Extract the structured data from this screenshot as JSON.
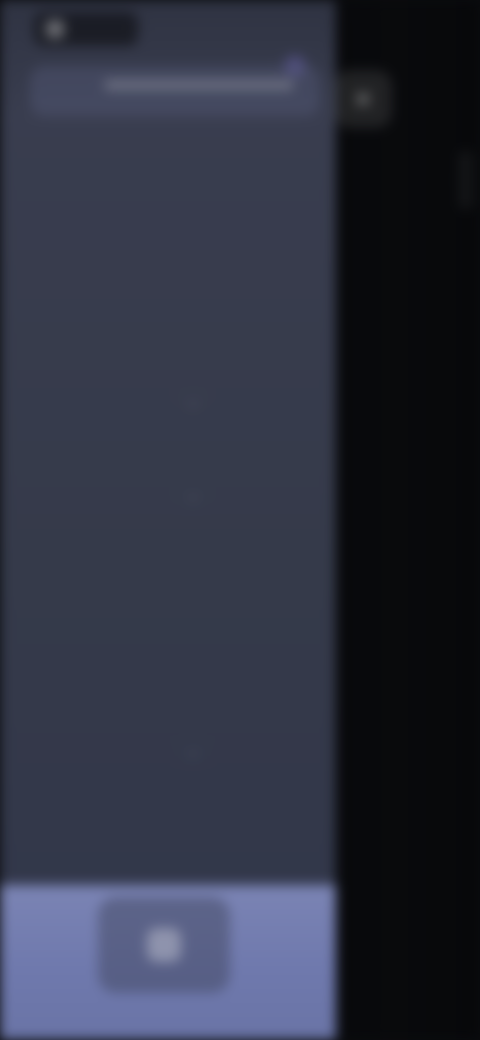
{
  "colors": {
    "drawer_bg": "#363b4b",
    "backdrop_bg": "#0a0b0e",
    "bottom_bar": "#6f79ad",
    "accent": "#9482ff"
  },
  "header": {
    "brand_label": "",
    "brand_icon": "app-icon",
    "close_icon": "close-icon"
  },
  "active_item": {
    "title": "",
    "subtitle_visible": true
  },
  "nav": {
    "items_top": [
      "",
      "",
      "",
      "",
      "",
      ""
    ],
    "section_1": {
      "title": "",
      "items": [
        ""
      ]
    },
    "section_2": {
      "title": "",
      "items": [
        "",
        "",
        "",
        "",
        ""
      ]
    },
    "section_3": {
      "title": "",
      "items": [
        "",
        ""
      ]
    }
  },
  "bottom": {
    "button_icon": "home-icon"
  }
}
